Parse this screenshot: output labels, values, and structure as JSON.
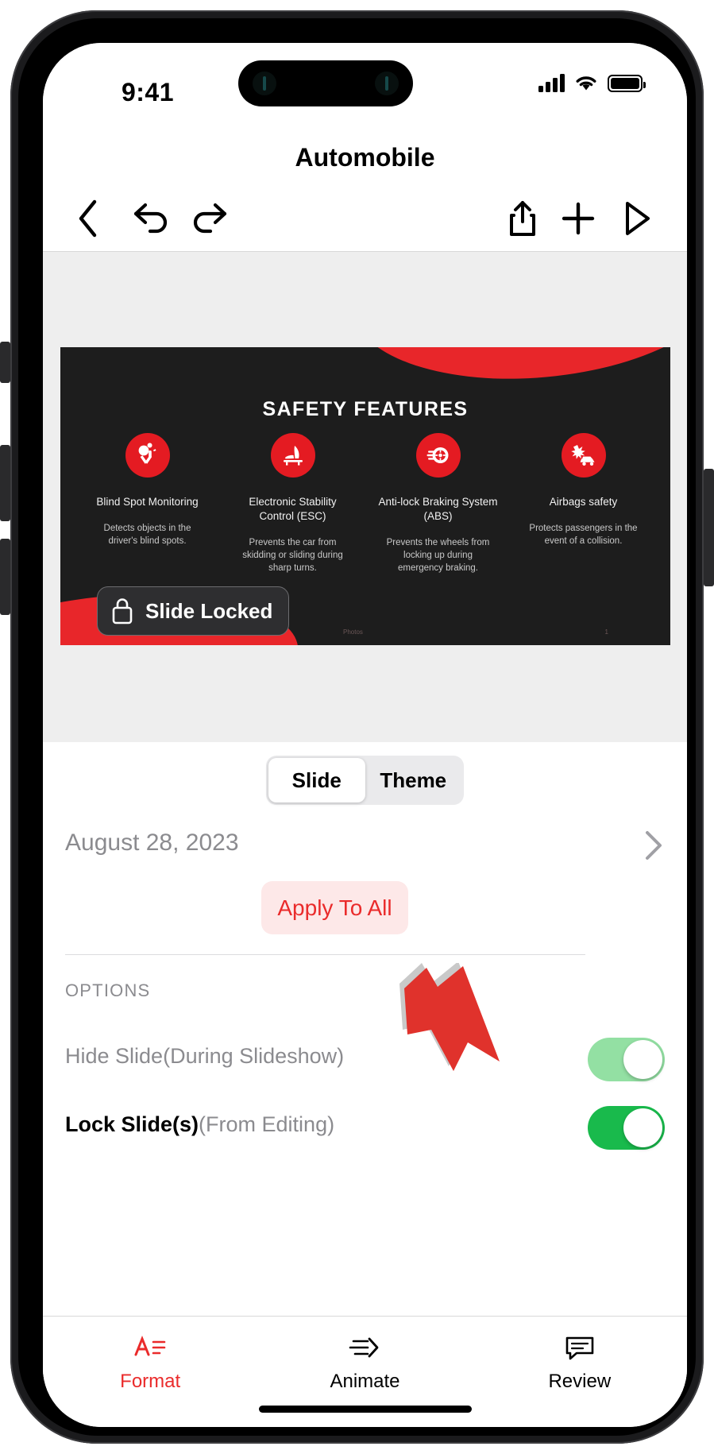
{
  "device": {
    "status_bar": {
      "time": "9:41",
      "signal_icon": "cellular-bars-icon",
      "wifi_icon": "wifi-icon",
      "battery_icon": "battery-full-icon"
    }
  },
  "header": {
    "title": "Automobile"
  },
  "toolbar": {
    "back_icon": "chevron-left-icon",
    "undo_icon": "undo-arrow-icon",
    "redo_icon": "redo-arrow-icon",
    "share_icon": "share-icon",
    "add_icon": "plus-icon",
    "play_icon": "play-triangle-icon"
  },
  "slide": {
    "title": "SAFETY FEATURES",
    "background_color": "#1d1d1d",
    "accent_color": "#e41b22",
    "locked_badge": {
      "label": "Slide Locked",
      "icon": "lock-icon"
    },
    "footer_left": "Photos",
    "footer_right": "1",
    "features": [
      {
        "icon": "airbag-person-icon",
        "title": "Blind Spot Monitoring",
        "desc": "Detects objects in the driver's blind spots."
      },
      {
        "icon": "car-seat-stability-icon",
        "title": "Electronic Stability Control (ESC)",
        "desc": "Prevents the car from skidding or sliding during sharp turns."
      },
      {
        "icon": "brake-disc-icon",
        "title": "Anti-lock Braking System (ABS)",
        "desc": "Prevents the wheels from locking up during emergency braking."
      },
      {
        "icon": "car-crash-airbag-icon",
        "title": "Airbags safety",
        "desc": "Protects passengers in the event of a collision."
      }
    ]
  },
  "inspector": {
    "segmented": {
      "options": [
        "Slide",
        "Theme"
      ],
      "selected": "Slide"
    },
    "date_row": {
      "label": "August 28, 2023",
      "chevron_icon": "chevron-right-icon"
    },
    "apply_button": {
      "label": "Apply To All",
      "text_color": "#ea2b2b",
      "background_color": "#fde8e8"
    },
    "options_section_title": "OPTIONS",
    "options": [
      {
        "label_strong": "Hide Slide",
        "label_muted": "(During Slideshow)",
        "toggle_state": "on",
        "toggle_style": "light-green",
        "toggle_color": "#93e0a3"
      },
      {
        "label_strong": "Lock Slide(s)",
        "label_muted": "(From Editing)",
        "toggle_state": "on",
        "toggle_style": "solid-green",
        "toggle_color": "#19ba4c"
      }
    ]
  },
  "annotation": {
    "arrow_icon": "red-arrow-pointer-icon",
    "color": "#e0322c"
  },
  "tabbar": {
    "tabs": [
      {
        "label": "Format",
        "icon": "format-text-icon",
        "active": true
      },
      {
        "label": "Animate",
        "icon": "animate-arrow-icon",
        "active": false
      },
      {
        "label": "Review",
        "icon": "comment-bubble-icon",
        "active": false
      }
    ]
  }
}
